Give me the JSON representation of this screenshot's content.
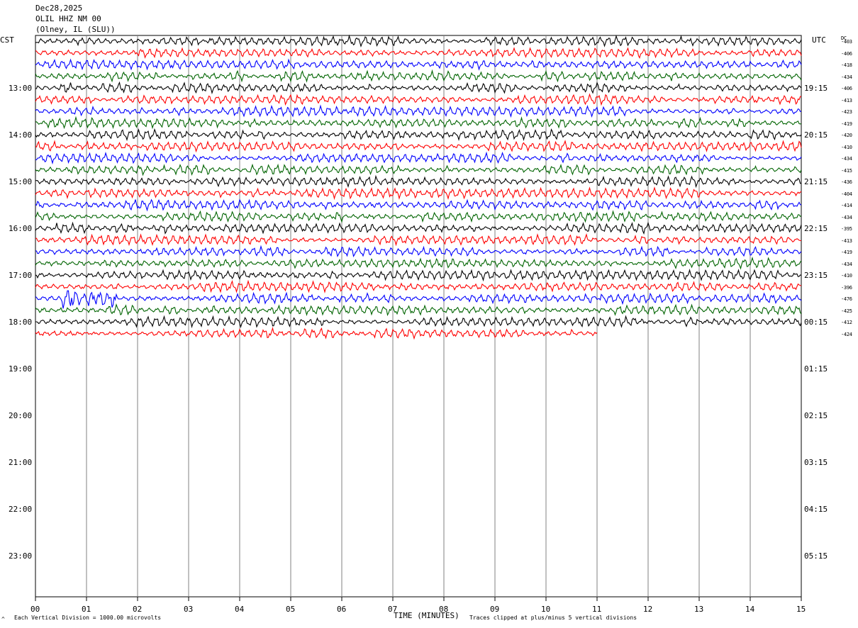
{
  "header": {
    "date": "Dec28,2025",
    "station": "OLIL HHZ NM 00",
    "location": "(Olney, IL (SLU))"
  },
  "left_tz": "CST",
  "right_tz": "UTC",
  "dc_label": "DC",
  "footer": {
    "scale_note": "Each Vertical Division = 1000.00 microvolts",
    "xlabel": "TIME (MINUTES)",
    "clip_note": "Traces clipped at plus/minus 5 vertical divisions",
    "corner_mark": "^"
  },
  "colors": {
    "trace_cycle": [
      "#000000",
      "#ff0000",
      "#0000ff",
      "#006400"
    ],
    "grid": "#808080"
  },
  "chart_data": {
    "type": "line",
    "title": "OLIL HHZ NM 00",
    "xlabel": "TIME (MINUTES)",
    "xlim": [
      0,
      15
    ],
    "x_ticks": [
      "00",
      "01",
      "02",
      "03",
      "04",
      "05",
      "06",
      "07",
      "08",
      "09",
      "10",
      "11",
      "12",
      "13",
      "14",
      "15"
    ],
    "left_hour_labels": [
      "13:00",
      "14:00",
      "15:00",
      "16:00",
      "17:00",
      "18:00",
      "19:00",
      "20:00",
      "21:00",
      "22:00",
      "23:00"
    ],
    "right_hour_labels": [
      "19:15",
      "20:15",
      "21:15",
      "22:15",
      "23:15",
      "00:15",
      "01:15",
      "02:15",
      "03:15",
      "04:15",
      "05:15"
    ],
    "traces_per_hour": 4,
    "minutes_per_trace": 15,
    "dc_offsets": [
      "403",
      "406",
      "418",
      "434",
      "406",
      "413",
      "423",
      "419",
      "420",
      "410",
      "434",
      "415",
      "436",
      "404",
      "414",
      "434",
      "395",
      "413",
      "419",
      "434",
      "410",
      "396",
      "476",
      "425",
      "412",
      "424"
    ],
    "last_trace_end_minute": 11,
    "clip_divisions": 5,
    "microvolts_per_division": 1000,
    "events": [
      {
        "trace_index": 22,
        "start_minute": 0.5,
        "end_minute": 1.6,
        "description": "high-amplitude burst"
      }
    ]
  }
}
